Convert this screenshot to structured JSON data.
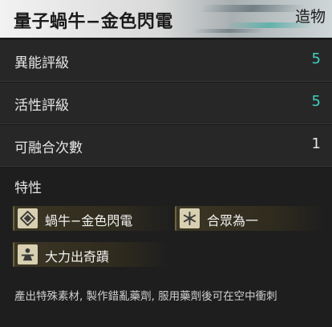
{
  "header": {
    "title": "量子蝸牛−金色閃電",
    "category": "造物"
  },
  "stats": [
    {
      "label": "異能評級",
      "value": "5"
    },
    {
      "label": "活性評級",
      "value": "5"
    },
    {
      "label": "可融合次數",
      "value": "1"
    }
  ],
  "traits": {
    "section_title": "特性",
    "items": [
      {
        "label": "蝸牛−金色閃電",
        "icon": "diamond-icon"
      },
      {
        "label": "合眾為一",
        "icon": "snowflake-icon"
      },
      {
        "label": "大力出奇蹟",
        "icon": "figure-icon"
      }
    ]
  },
  "description": "產出特殊素材, 製作錯亂藥劑, 服用藥劑後可在空中衝刺",
  "colors": {
    "accent": "#3fd2c0",
    "trait_bg": "#3b3624"
  }
}
